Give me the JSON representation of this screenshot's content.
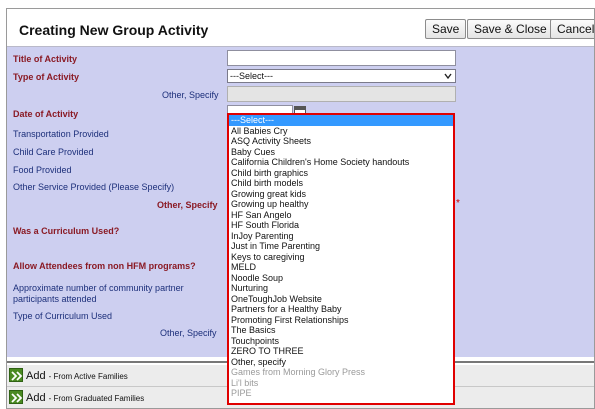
{
  "header": {
    "title": "Creating New Group Activity",
    "save_label": "Save",
    "save_close_label": "Save & Close",
    "cancel_label": "Cancel"
  },
  "form": {
    "title_label": "Title of Activity",
    "type_label": "Type of Activity",
    "type_select_value": "---Select---",
    "type_other_label": "Other, Specify",
    "date_label": "Date of Activity",
    "transportation_label": "Transportation Provided",
    "childcare_label": "Child Care Provided",
    "food_label": "Food Provided",
    "other_service_label": "Other Service Provided (Please Specify)",
    "other_service_specify_label": "Other, Specify",
    "curriculum_used_label": "Was a Curriculum Used?",
    "allow_attendees_label": "Allow Attendees from non HFM programs?",
    "community_partner_label_1": "Approximate number of community partner",
    "community_partner_label_2": "participants attended",
    "curriculum_type_label": "Type of Curriculum Used",
    "curriculum_other_label": "Other, Specify",
    "required_mark": "*"
  },
  "dropdown": {
    "options": [
      {
        "label": "---Select---",
        "state": "selected"
      },
      {
        "label": "All Babies Cry",
        "state": "enabled"
      },
      {
        "label": "ASQ Activity Sheets",
        "state": "enabled"
      },
      {
        "label": "Baby Cues",
        "state": "enabled"
      },
      {
        "label": "California Children's Home Society handouts",
        "state": "enabled"
      },
      {
        "label": "Child birth graphics",
        "state": "enabled"
      },
      {
        "label": "Child birth models",
        "state": "enabled"
      },
      {
        "label": "Growing great kids",
        "state": "enabled"
      },
      {
        "label": "Growing up healthy",
        "state": "enabled"
      },
      {
        "label": "HF San Angelo",
        "state": "enabled"
      },
      {
        "label": "HF South Florida",
        "state": "enabled"
      },
      {
        "label": "InJoy Parenting",
        "state": "enabled"
      },
      {
        "label": "Just in Time Parenting",
        "state": "enabled"
      },
      {
        "label": "Keys to caregiving",
        "state": "enabled"
      },
      {
        "label": "MELD",
        "state": "enabled"
      },
      {
        "label": "Noodle Soup",
        "state": "enabled"
      },
      {
        "label": "Nurturing",
        "state": "enabled"
      },
      {
        "label": "OneToughJob Website",
        "state": "enabled"
      },
      {
        "label": "Partners for a Healthy Baby",
        "state": "enabled"
      },
      {
        "label": "Promoting First Relationships",
        "state": "enabled"
      },
      {
        "label": "The Basics",
        "state": "enabled"
      },
      {
        "label": "Touchpoints",
        "state": "enabled"
      },
      {
        "label": "ZERO TO THREE",
        "state": "enabled"
      },
      {
        "label": "Other, specify",
        "state": "enabled"
      },
      {
        "label": "Games from Morning Glory Press",
        "state": "disabled"
      },
      {
        "label": "Li'l bits",
        "state": "disabled"
      },
      {
        "label": "PIPE",
        "state": "disabled"
      }
    ]
  },
  "attendees": {
    "add_active_label": "Add",
    "add_active_sub": "- From Active Families",
    "add_graduated_label": "Add",
    "add_graduated_sub": "- From Graduated Families"
  },
  "icons": {
    "calendar": "calendar-icon",
    "add": "double-chevron-right-icon",
    "select_arrow": "chevron-down-icon"
  },
  "colors": {
    "form_background": "#cdcff0",
    "label_blue": "#1c2f7a",
    "label_red": "#8a1a24",
    "dropdown_border": "#e00000",
    "selected_option": "#3399ff",
    "add_icon_green": "#4a8a22"
  }
}
